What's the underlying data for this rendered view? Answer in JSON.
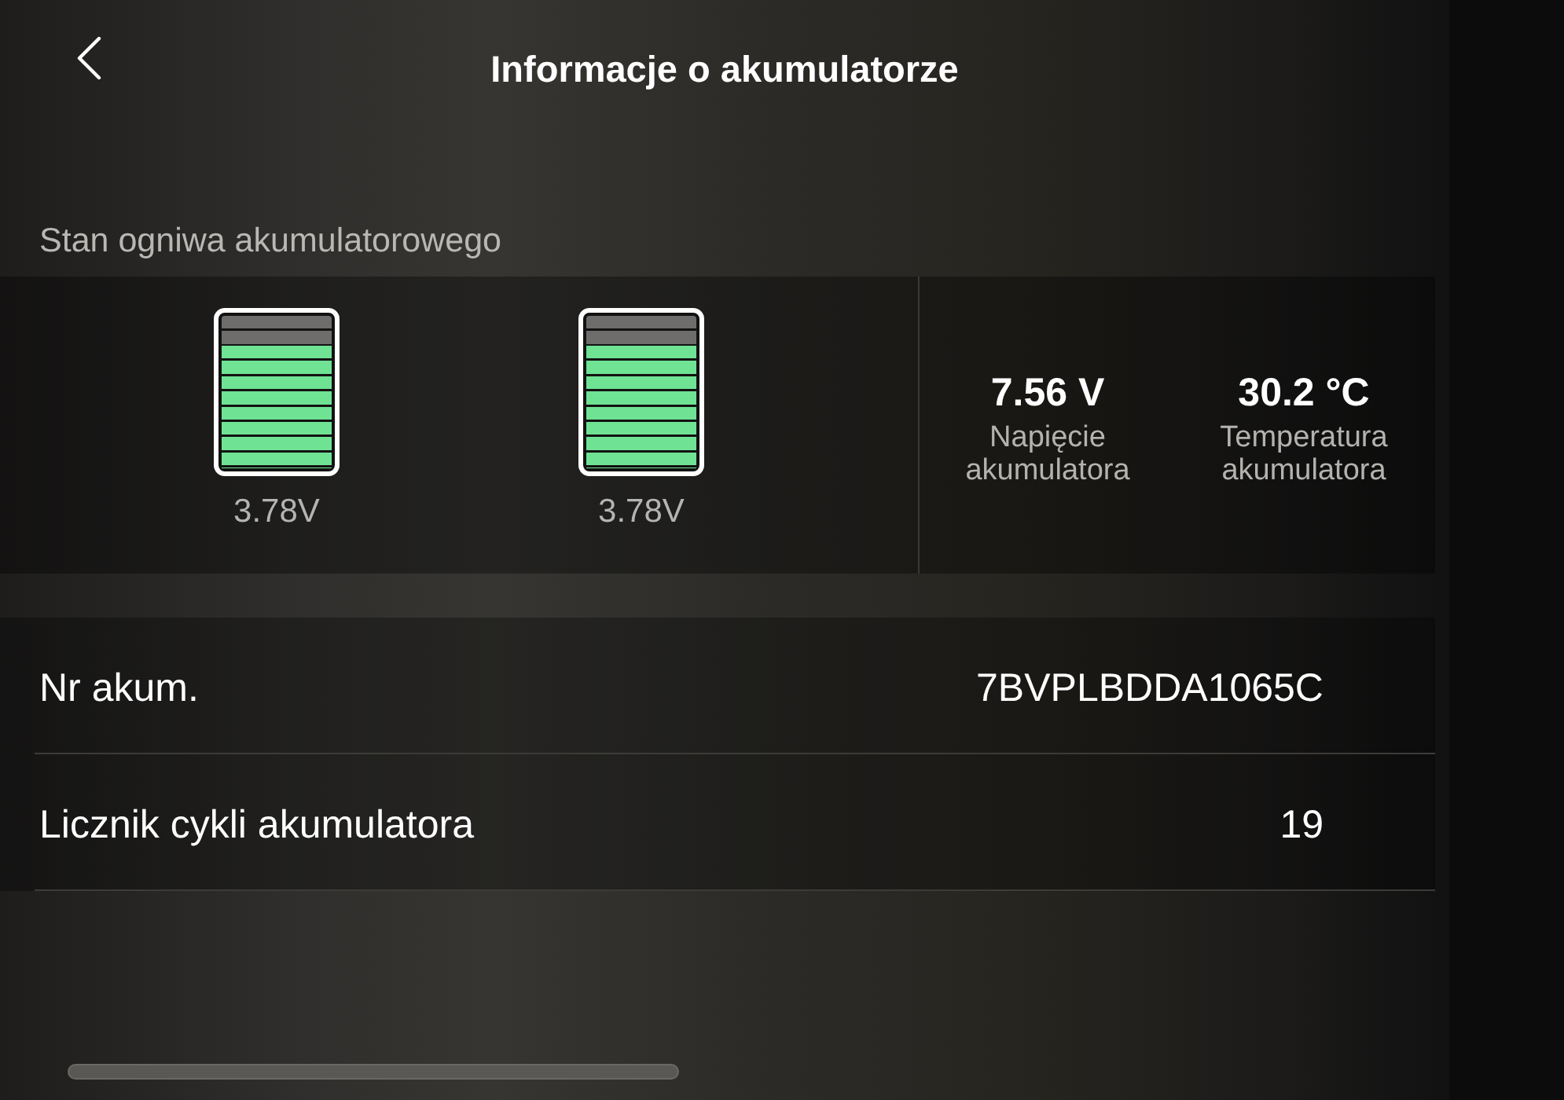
{
  "header": {
    "title": "Informacje o akumulatorze"
  },
  "cells_section": {
    "heading": "Stan ogniwa akumulatorowego",
    "cells": [
      {
        "level": 0.8,
        "voltage": "3.78V"
      },
      {
        "level": 0.8,
        "voltage": "3.78V"
      }
    ],
    "stats": [
      {
        "value": "7.56 V",
        "label": "Napięcie akumulatora"
      },
      {
        "value": "30.2 °C",
        "label": "Temperatura akumulatora"
      }
    ]
  },
  "info_rows": [
    {
      "label": "Nr akum.",
      "value": "7BVPLBDDA1065C"
    },
    {
      "label": "Licznik cykli akumulatora",
      "value": "19"
    }
  ]
}
